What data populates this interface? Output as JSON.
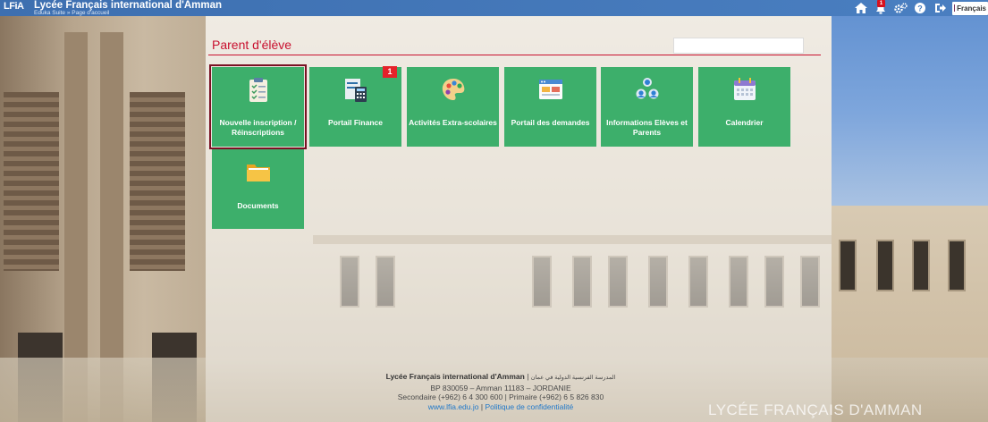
{
  "app": {
    "logo_text": "LFiA",
    "title": "Lycée Français international d'Amman",
    "breadcrumb": "Eduka Suite » Page d'accueil"
  },
  "topbar": {
    "icons": [
      "home-icon",
      "bell-icon",
      "cogs-icon",
      "help-icon",
      "logout-icon"
    ],
    "notification_count": "1",
    "language": "Français",
    "colors": {
      "bar": "#4a7fc1",
      "badge": "#d6111e"
    }
  },
  "section": {
    "title": "Parent d'élève",
    "search_value": ""
  },
  "tiles": [
    {
      "label": "Nouvelle inscription / Réinscriptions",
      "icon": "clipboard-checklist-icon",
      "selected": true
    },
    {
      "label": "Portail Finance",
      "icon": "calculator-document-icon",
      "badge": "1"
    },
    {
      "label": "Activités Extra-scolaires",
      "icon": "palette-icon"
    },
    {
      "label": "Portail des demandes",
      "icon": "browser-window-icon"
    },
    {
      "label": "Informations Elèves et Parents",
      "icon": "people-icon"
    },
    {
      "label": "Calendrier",
      "icon": "calendar-icon"
    },
    {
      "label": "Documents",
      "icon": "folder-icon"
    }
  ],
  "tile_color": "#3daf6b",
  "footer": {
    "school_name": "Lycée Français international d'Amman",
    "arabic_name": "المدرسة الفرنسية الدولية في عمان",
    "address": "BP 830059 – Amman 11183 – JORDANIE",
    "phones": "Secondaire (+962) 6 4 300 600 | Primaire (+962) 6 5 826 830",
    "website": "www.lfia.edu.jo",
    "privacy": "Politique de confidentialité"
  },
  "background_watermark": "LYCÉE FRANÇAIS D'AMMAN"
}
